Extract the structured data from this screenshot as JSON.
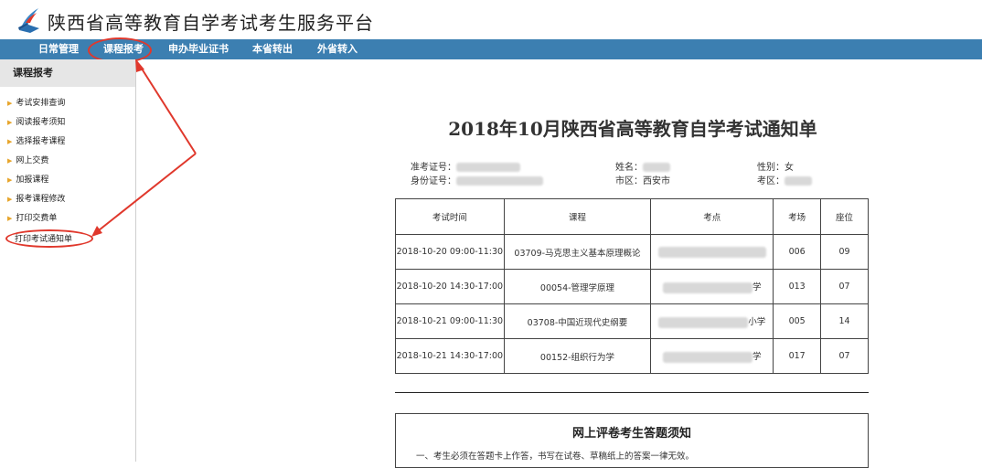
{
  "header": {
    "site_title": "陕西省高等教育自学考试考生服务平台",
    "logo_icon": "book-logo-icon"
  },
  "nav": {
    "items": [
      {
        "label": "日常管理"
      },
      {
        "label": "课程报考"
      },
      {
        "label": "申办毕业证书"
      },
      {
        "label": "本省转出"
      },
      {
        "label": "外省转入"
      }
    ],
    "active": "课程报考"
  },
  "sidebar": {
    "heading": "课程报考",
    "items": [
      {
        "label": "考试安排查询"
      },
      {
        "label": "阅读报考须知"
      },
      {
        "label": "选择报考课程"
      },
      {
        "label": "网上交费"
      },
      {
        "label": "加报课程"
      },
      {
        "label": "报考课程修改"
      },
      {
        "label": "打印交费单"
      },
      {
        "label": "打印考试通知单"
      }
    ]
  },
  "notice": {
    "title": "2018年10月陕西省高等教育自学考试通知单",
    "admission_label": "准考证号：",
    "id_label": "身份证号：",
    "name_label": "姓名：",
    "city_label": "市区：",
    "city_value": "西安市",
    "gender_label": "性别：",
    "gender_value": "女",
    "district_label": "考区："
  },
  "table": {
    "headers": [
      "考试时间",
      "课程",
      "考点",
      "考场",
      "座位"
    ],
    "rows": [
      {
        "time": "2018-10-20 09:00-11:30",
        "course": "03709-马克思主义基本原理概论",
        "site_tail": "",
        "room": "006",
        "seat": "09"
      },
      {
        "time": "2018-10-20 14:30-17:00",
        "course": "00054-管理学原理",
        "site_tail": "学",
        "room": "013",
        "seat": "07"
      },
      {
        "time": "2018-10-21 09:00-11:30",
        "course": "03708-中国近现代史纲要",
        "site_tail": "小学",
        "room": "005",
        "seat": "14"
      },
      {
        "time": "2018-10-21 14:30-17:00",
        "course": "00152-组织行为学",
        "site_tail": "学",
        "room": "017",
        "seat": "07"
      }
    ]
  },
  "rules": {
    "title": "网上评卷考生答题须知",
    "line1": "一、考生必须在答题卡上作答，书写在试卷、草稿纸上的答案一律无效。"
  },
  "colors": {
    "navbar": "#3c7fb1",
    "annotation": "#e0382c",
    "bullet": "#e7a52b"
  }
}
